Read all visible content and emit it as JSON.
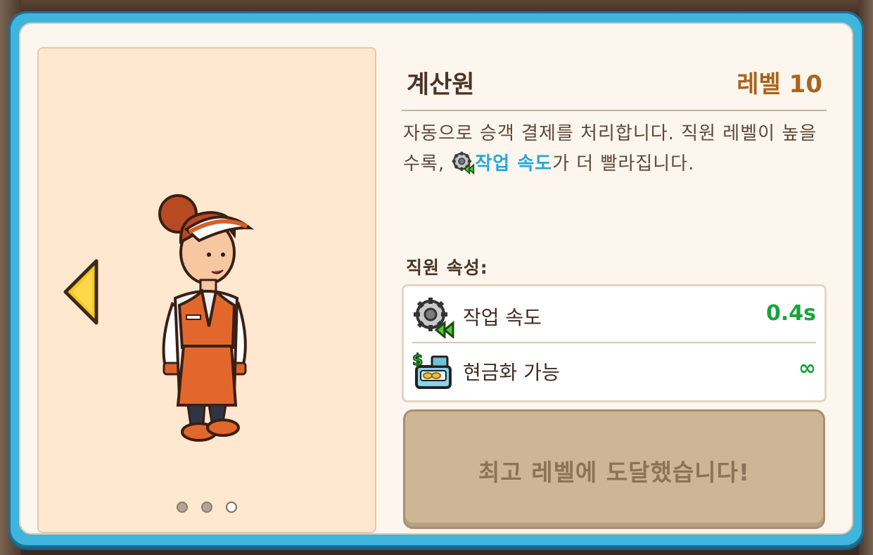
{
  "staff": {
    "name": "계산원",
    "level_label": "레벨 10",
    "description_before": "자동으로 승객 결제를 처리합니다. 직원 레벨이 높을수록, ",
    "description_highlight": "작업 속도",
    "description_after": "가 더 빨라집니다."
  },
  "attributes": {
    "header": "직원 속성:",
    "items": [
      {
        "name": "작업 속도",
        "value": "0.4s",
        "icon": "gear-speed-icon"
      },
      {
        "name": "현금화 가능",
        "value": "∞",
        "icon": "cash-register-icon"
      }
    ]
  },
  "max_button": {
    "label": "최고 레벨에 도달했습니다!"
  },
  "pagination": {
    "total": 3,
    "active_index": 2
  },
  "colors": {
    "frame": "#3fb4dc",
    "panel": "#fdf6ee",
    "portrait_bg": "#ffe8cf",
    "level_text": "#a8641d",
    "highlight": "#28a7d8",
    "attr_value": "#18a33a",
    "button": "#cdb596"
  }
}
